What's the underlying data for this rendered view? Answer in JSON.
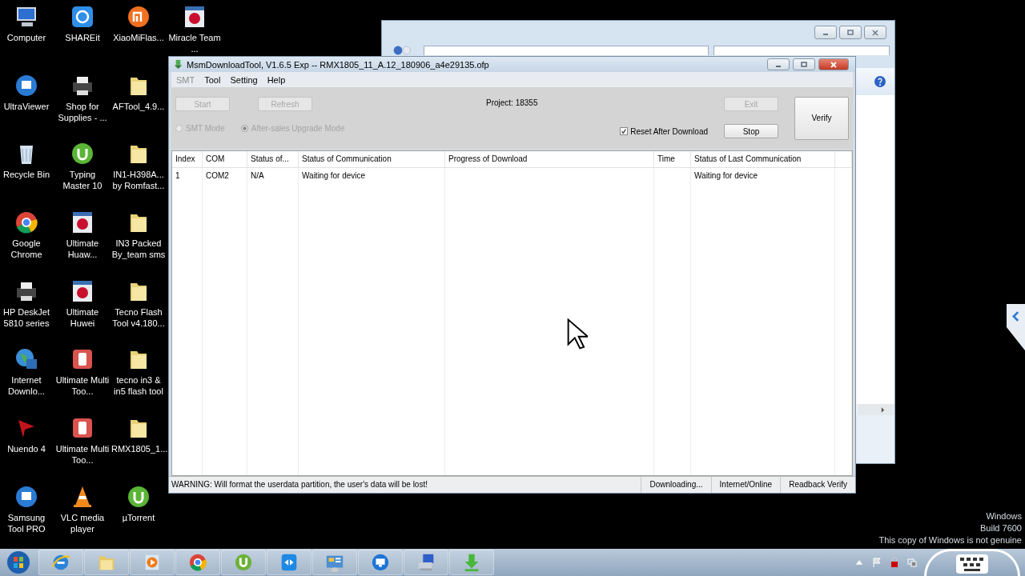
{
  "desktop": {
    "columns": [
      [
        {
          "label": "Computer",
          "kind": "computer"
        },
        {
          "label": "UltraViewer",
          "kind": "roundapp"
        },
        {
          "label": "Recycle Bin",
          "kind": "bin"
        },
        {
          "label": "Google Chrome",
          "kind": "chrome"
        },
        {
          "label": "HP DeskJet 5810 series",
          "kind": "printer"
        },
        {
          "label": "Internet Downlo...",
          "kind": "globe"
        },
        {
          "label": "Nuendo 4",
          "kind": "flag"
        },
        {
          "label": "Samsung Tool PRO",
          "kind": "roundapp"
        }
      ],
      [
        {
          "label": "SHAREit",
          "kind": "squareapp"
        },
        {
          "label": "Shop for Supplies - ...",
          "kind": "printer"
        },
        {
          "label": "Typing Master 10",
          "kind": "greenapp"
        },
        {
          "label": "Ultimate Huaw...",
          "kind": "tile"
        },
        {
          "label": "Ultimate Huwei",
          "kind": "tile"
        },
        {
          "label": "Ultimate Multi Too...",
          "kind": "redapp"
        },
        {
          "label": "Ultimate Multi Too...",
          "kind": "redapp"
        },
        {
          "label": "VLC media player",
          "kind": "cone"
        }
      ],
      [
        {
          "label": "XiaoMiFlas...",
          "kind": "orangeapp"
        },
        {
          "label": "AFTool_4.9...",
          "kind": "folder"
        },
        {
          "label": "IN1-H398A... by Romfast...",
          "kind": "folder"
        },
        {
          "label": "IN3 Packed By_team sms",
          "kind": "folder"
        },
        {
          "label": "Tecno Flash Tool v4.180...",
          "kind": "folder"
        },
        {
          "label": "tecno in3 & in5 flash tool",
          "kind": "folder"
        },
        {
          "label": "RMX1805_1...",
          "kind": "folder"
        },
        {
          "label": "µTorrent",
          "kind": "greenapp"
        }
      ],
      [
        {
          "label": "Miracle Team ...",
          "kind": "tile"
        }
      ]
    ]
  },
  "window": {
    "title": "MsmDownloadTool, V1.6.5 Exp -- RMX1805_11_A.12_180906_a4e29135.ofp"
  },
  "menu": [
    {
      "label": "SMT",
      "disabled": true
    },
    {
      "label": "Tool",
      "disabled": false
    },
    {
      "label": "Setting",
      "disabled": false
    },
    {
      "label": "Help",
      "disabled": false
    }
  ],
  "buttons": {
    "start": {
      "label": "Start",
      "disabled": true
    },
    "refresh": {
      "label": "Refresh",
      "disabled": true
    },
    "exit": {
      "label": "Exit",
      "disabled": true
    },
    "stop": {
      "label": "Stop",
      "disabled": false
    },
    "verify": {
      "label": "Verify",
      "disabled": false
    }
  },
  "project": "Project: 18355",
  "modes": [
    {
      "label": "SMT Mode",
      "selected": false,
      "disabled": true
    },
    {
      "label": "After-sales Upgrade Mode",
      "selected": true,
      "disabled": true
    }
  ],
  "reset_after_download": {
    "label": "Reset After Download",
    "checked": true
  },
  "table": {
    "columns": [
      "Index",
      "COM",
      "Status of...",
      "Status of Communication",
      "Progress of Download",
      "Time",
      "Status of Last Communication"
    ],
    "rows": [
      {
        "index": "1",
        "com": "COM2",
        "status": "N/A",
        "communication": "Waiting for device",
        "last_communication": "Waiting for device"
      }
    ]
  },
  "status_bar": [
    "WARNING: Will format the userdata partition, the user's data will be lost!",
    "Downloading...",
    "Internet/Online",
    "Readback Verify"
  ],
  "windows_notice": [
    "Windows",
    "Build 7600",
    "This copy of Windows is not genuine"
  ],
  "taskbar": {
    "apps": [
      {
        "kind": "ie"
      },
      {
        "kind": "folder"
      },
      {
        "kind": "player"
      },
      {
        "kind": "chrome"
      },
      {
        "kind": "torrent"
      },
      {
        "kind": "remote"
      },
      {
        "kind": "panel"
      },
      {
        "kind": "monitor"
      },
      {
        "kind": "computer"
      },
      {
        "kind": "download"
      }
    ]
  }
}
